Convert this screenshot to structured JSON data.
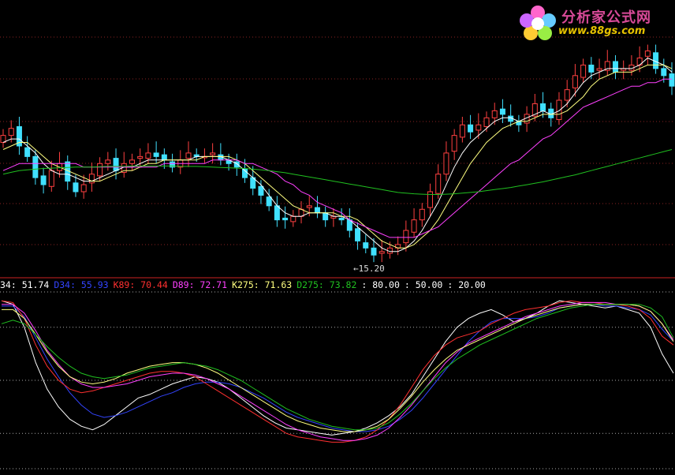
{
  "logo": {
    "title": "分析家公式网",
    "url": "www.88gs.com"
  },
  "indicator_header": [
    {
      "label": "34",
      "value": "51.74",
      "color": "#ffffff"
    },
    {
      "label": "D34",
      "value": "55.93",
      "color": "#3344ff"
    },
    {
      "label": "K89",
      "value": "70.44",
      "color": "#ff3030"
    },
    {
      "label": "D89",
      "value": "72.71",
      "color": "#ff40ff"
    },
    {
      "label": "K275",
      "value": "71.63",
      "color": "#ffff80"
    },
    {
      "label": "D275",
      "value": "73.82",
      "color": "#20c020"
    },
    {
      "label": "",
      "value": "80.00",
      "color": "#ffffff"
    },
    {
      "label": "",
      "value": "50.00",
      "color": "#ffffff"
    },
    {
      "label": "",
      "value": "20.00",
      "color": "#ffffff"
    }
  ],
  "low_marker": "15.20",
  "colors": {
    "background": "#000000",
    "grid": "#8a2222",
    "divider": "#cc2222",
    "candle_up": "#ff4040",
    "candle_down": "#40e0ff",
    "ma_short": "#ffffff",
    "ma_mid": "#ffff80",
    "ma_long": "#ff40ff",
    "ma_longest": "#20c020"
  },
  "chart_data": [
    {
      "type": "candlestick",
      "title": "",
      "annotations": [
        "15.20"
      ],
      "closes": [
        18.6,
        18.8,
        18.3,
        18.0,
        17.4,
        17.2,
        17.6,
        17.8,
        17.3,
        17.0,
        17.2,
        17.5,
        17.8,
        17.9,
        17.6,
        17.8,
        17.9,
        18.0,
        18.1,
        18.0,
        17.9,
        17.7,
        17.9,
        18.1,
        18.0,
        18.0,
        18.1,
        17.9,
        17.8,
        17.7,
        17.4,
        17.1,
        16.9,
        16.6,
        16.2,
        16.2,
        16.3,
        16.5,
        16.6,
        16.4,
        16.2,
        16.3,
        16.2,
        15.9,
        15.6,
        15.4,
        15.2,
        15.3,
        15.4,
        15.5,
        15.9,
        16.2,
        16.5,
        17.0,
        17.5,
        18.1,
        18.6,
        18.9,
        18.7,
        18.9,
        19.1,
        19.3,
        19.2,
        19.0,
        18.9,
        19.2,
        19.5,
        19.3,
        19.1,
        19.6,
        19.9,
        20.3,
        20.6,
        20.4,
        20.5,
        20.7,
        20.4,
        20.5,
        20.6,
        20.8,
        21.0,
        20.5,
        20.3,
        20.0
      ],
      "ma_short": [
        18.4,
        18.5,
        18.5,
        18.3,
        18.1,
        17.8,
        17.6,
        17.5,
        17.5,
        17.4,
        17.3,
        17.3,
        17.4,
        17.5,
        17.6,
        17.7,
        17.7,
        17.8,
        17.9,
        17.9,
        17.9,
        17.9,
        17.9,
        17.9,
        18.0,
        18.0,
        18.0,
        18.0,
        17.9,
        17.8,
        17.6,
        17.4,
        17.2,
        16.9,
        16.6,
        16.4,
        16.3,
        16.3,
        16.4,
        16.4,
        16.4,
        16.3,
        16.3,
        16.2,
        16.0,
        15.8,
        15.6,
        15.4,
        15.3,
        15.3,
        15.4,
        15.6,
        15.9,
        16.3,
        16.7,
        17.2,
        17.7,
        18.1,
        18.4,
        18.6,
        18.8,
        19.0,
        19.1,
        19.1,
        19.0,
        19.1,
        19.2,
        19.3,
        19.2,
        19.3,
        19.5,
        19.8,
        20.1,
        20.3,
        20.4,
        20.5,
        20.5,
        20.5,
        20.5,
        20.6,
        20.8,
        20.7,
        20.6,
        20.4
      ],
      "ma_mid": [
        18.2,
        18.3,
        18.4,
        18.4,
        18.2,
        18.0,
        17.8,
        17.7,
        17.6,
        17.5,
        17.4,
        17.3,
        17.3,
        17.4,
        17.5,
        17.6,
        17.6,
        17.7,
        17.8,
        17.8,
        17.9,
        17.9,
        17.9,
        17.9,
        17.9,
        18.0,
        18.0,
        18.0,
        18.0,
        17.9,
        17.8,
        17.6,
        17.4,
        17.2,
        17.0,
        16.8,
        16.6,
        16.5,
        16.4,
        16.4,
        16.4,
        16.4,
        16.3,
        16.3,
        16.2,
        16.0,
        15.8,
        15.6,
        15.5,
        15.4,
        15.4,
        15.5,
        15.7,
        15.9,
        16.2,
        16.6,
        17.0,
        17.4,
        17.8,
        18.1,
        18.4,
        18.6,
        18.8,
        18.9,
        19.0,
        19.0,
        19.1,
        19.2,
        19.2,
        19.2,
        19.3,
        19.5,
        19.7,
        20.0,
        20.2,
        20.3,
        20.4,
        20.4,
        20.4,
        20.5,
        20.6,
        20.6,
        20.6,
        20.5
      ],
      "ma_long": [
        17.6,
        17.7,
        17.8,
        17.8,
        17.8,
        17.8,
        17.8,
        17.8,
        17.8,
        17.8,
        17.7,
        17.7,
        17.7,
        17.7,
        17.7,
        17.7,
        17.7,
        17.7,
        17.7,
        17.7,
        17.8,
        17.8,
        17.8,
        17.8,
        17.8,
        17.8,
        17.9,
        17.9,
        17.9,
        17.9,
        17.8,
        17.8,
        17.7,
        17.6,
        17.5,
        17.3,
        17.2,
        17.0,
        16.9,
        16.7,
        16.6,
        16.5,
        16.4,
        16.2,
        16.1,
        16.0,
        15.9,
        15.8,
        15.7,
        15.7,
        15.7,
        15.7,
        15.8,
        15.9,
        16.0,
        16.2,
        16.4,
        16.6,
        16.8,
        17.0,
        17.2,
        17.4,
        17.6,
        17.8,
        17.9,
        18.1,
        18.3,
        18.5,
        18.6,
        18.8,
        19.0,
        19.2,
        19.4,
        19.5,
        19.6,
        19.7,
        19.8,
        19.9,
        20.0,
        20.0,
        20.1,
        20.1,
        20.2,
        20.2
      ],
      "ma_longest": [
        17.5,
        17.55,
        17.6,
        17.62,
        17.64,
        17.66,
        17.67,
        17.68,
        17.69,
        17.7,
        17.7,
        17.7,
        17.71,
        17.72,
        17.72,
        17.72,
        17.73,
        17.73,
        17.73,
        17.73,
        17.73,
        17.73,
        17.72,
        17.72,
        17.72,
        17.71,
        17.7,
        17.69,
        17.68,
        17.67,
        17.66,
        17.64,
        17.62,
        17.6,
        17.57,
        17.54,
        17.5,
        17.46,
        17.42,
        17.38,
        17.34,
        17.3,
        17.26,
        17.22,
        17.18,
        17.14,
        17.1,
        17.06,
        17.02,
        16.98,
        16.96,
        16.94,
        16.93,
        16.92,
        16.92,
        16.93,
        16.94,
        16.96,
        16.98,
        17.0,
        17.03,
        17.06,
        17.09,
        17.12,
        17.16,
        17.2,
        17.24,
        17.28,
        17.33,
        17.38,
        17.43,
        17.48,
        17.54,
        17.6,
        17.66,
        17.72,
        17.78,
        17.84,
        17.9,
        17.96,
        18.02,
        18.08,
        18.14,
        18.2
      ],
      "ylim": [
        14.6,
        22.0
      ]
    },
    {
      "type": "line",
      "title": "",
      "ylim": [
        0,
        100
      ],
      "reference_levels": [
        80.0,
        50.0,
        20.0
      ],
      "series": [
        {
          "name": "K34",
          "color": "#ffffff",
          "values": [
            95,
            93,
            80,
            60,
            45,
            35,
            28,
            24,
            22,
            25,
            30,
            35,
            40,
            42,
            45,
            48,
            50,
            52,
            51,
            49,
            45,
            40,
            35,
            30,
            26,
            23,
            22,
            21,
            20,
            19,
            20,
            21,
            23,
            26,
            30,
            35,
            42,
            52,
            62,
            72,
            80,
            85,
            88,
            90,
            87,
            83,
            85,
            88,
            92,
            95,
            94,
            93,
            92,
            91,
            92,
            90,
            88,
            80,
            65,
            54
          ]
        },
        {
          "name": "D34",
          "color": "#3344ff",
          "values": [
            92,
            92,
            86,
            74,
            62,
            52,
            43,
            36,
            31,
            29,
            30,
            32,
            35,
            38,
            41,
            43,
            46,
            48,
            49,
            49,
            48,
            46,
            43,
            40,
            36,
            32,
            29,
            27,
            25,
            23,
            22,
            21,
            21,
            22,
            24,
            28,
            33,
            40,
            48,
            56,
            64,
            72,
            78,
            83,
            85,
            85,
            85,
            86,
            88,
            91,
            92,
            93,
            93,
            92,
            92,
            91,
            90,
            87,
            79,
            72
          ]
        },
        {
          "name": "K89",
          "color": "#ff3030",
          "values": [
            95,
            94,
            85,
            70,
            58,
            50,
            45,
            43,
            44,
            46,
            48,
            50,
            52,
            54,
            55,
            55,
            54,
            52,
            48,
            44,
            40,
            36,
            32,
            28,
            24,
            20,
            18,
            17,
            16,
            15,
            15,
            16,
            18,
            22,
            28,
            36,
            46,
            56,
            64,
            70,
            74,
            76,
            78,
            82,
            85,
            88,
            90,
            91,
            92,
            94,
            95,
            94,
            94,
            93,
            93,
            92,
            90,
            85,
            75,
            70
          ]
        },
        {
          "name": "D89",
          "color": "#ff40ff",
          "values": [
            93,
            93,
            88,
            78,
            67,
            59,
            52,
            48,
            46,
            46,
            47,
            48,
            50,
            52,
            53,
            54,
            54,
            53,
            51,
            48,
            45,
            41,
            37,
            33,
            29,
            25,
            22,
            20,
            18,
            17,
            16,
            16,
            17,
            19,
            23,
            29,
            36,
            44,
            52,
            60,
            66,
            71,
            74,
            77,
            80,
            83,
            86,
            88,
            90,
            92,
            93,
            94,
            94,
            94,
            93,
            93,
            92,
            89,
            82,
            73
          ]
        },
        {
          "name": "K275",
          "color": "#ffff80",
          "values": [
            90,
            90,
            85,
            76,
            66,
            58,
            52,
            49,
            48,
            49,
            51,
            54,
            56,
            58,
            59,
            60,
            60,
            59,
            57,
            54,
            50,
            46,
            42,
            38,
            34,
            30,
            27,
            25,
            23,
            22,
            21,
            21,
            22,
            24,
            28,
            34,
            41,
            49,
            56,
            62,
            67,
            70,
            73,
            76,
            79,
            82,
            85,
            87,
            89,
            91,
            92,
            93,
            93,
            93,
            93,
            93,
            92,
            89,
            82,
            72
          ]
        },
        {
          "name": "D275",
          "color": "#20c020",
          "values": [
            82,
            84,
            82,
            76,
            69,
            63,
            58,
            54,
            52,
            51,
            52,
            53,
            55,
            57,
            58,
            59,
            60,
            59,
            58,
            56,
            53,
            50,
            46,
            42,
            38,
            34,
            31,
            28,
            26,
            24,
            23,
            22,
            22,
            23,
            26,
            31,
            37,
            44,
            51,
            57,
            62,
            66,
            70,
            73,
            76,
            79,
            82,
            85,
            87,
            89,
            91,
            92,
            93,
            93,
            93,
            93,
            93,
            91,
            86,
            74
          ]
        }
      ]
    }
  ]
}
